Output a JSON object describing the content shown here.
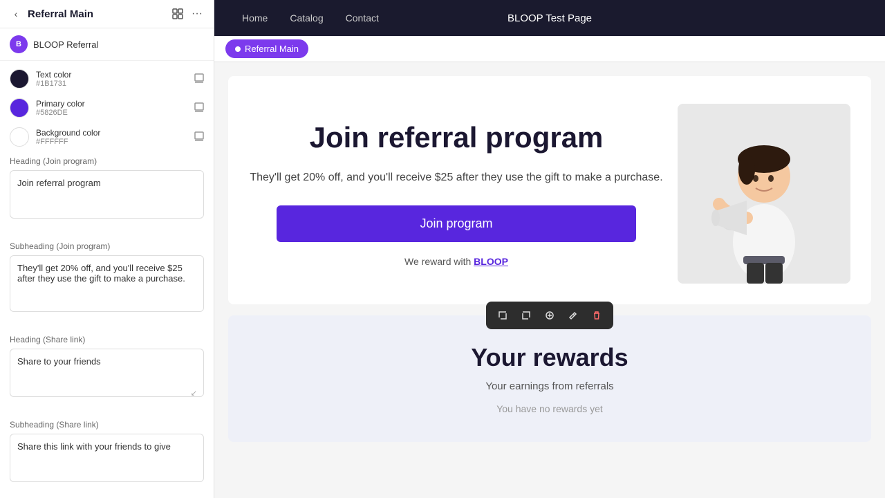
{
  "sidebar": {
    "title": "Referral Main",
    "back_label": "‹",
    "app": {
      "icon_text": "B",
      "name": "BLOOP Referral"
    },
    "colors": [
      {
        "id": "text-color",
        "label": "Text color",
        "value": "#1B1731",
        "swatch": "#1B1731"
      },
      {
        "id": "primary-color",
        "label": "Primary color",
        "value": "#5826DE",
        "swatch": "#5826DE"
      },
      {
        "id": "bg-color",
        "label": "Background color",
        "value": "#FFFFFF",
        "swatch": "#FFFFFF"
      }
    ],
    "fields": [
      {
        "section_label": "Heading (Join program)",
        "value": "Join referral program",
        "rows": 3
      },
      {
        "section_label": "Subheading (Join program)",
        "value": "They'll get 20% off, and you'll receive $25 after they use the gift to make a purchase.",
        "rows": 4
      },
      {
        "section_label": "Heading (Share link)",
        "value": "Share to your friends",
        "rows": 3
      },
      {
        "section_label": "Subheading (Share link)",
        "value": "Share this link with your friends to give",
        "rows": 2
      }
    ]
  },
  "nav": {
    "links": [
      "Home",
      "Catalog",
      "Contact"
    ],
    "title": "BLOOP Test Page",
    "active_tab": "Referral Main"
  },
  "join_section": {
    "heading": "Join referral program",
    "subheading": "They'll get 20% off, and you'll receive $25 after they use the gift to make a purchase.",
    "button_label": "Join program",
    "reward_text": "We reward with ",
    "reward_link_text": "BLOOP"
  },
  "rewards_section": {
    "heading": "Your rewards",
    "subheading": "Your earnings from referrals",
    "empty_text": "You have no rewards yet"
  },
  "toolbar": {
    "buttons": [
      "⬑",
      "⬐",
      "⊕",
      "✎",
      "🗑"
    ]
  }
}
